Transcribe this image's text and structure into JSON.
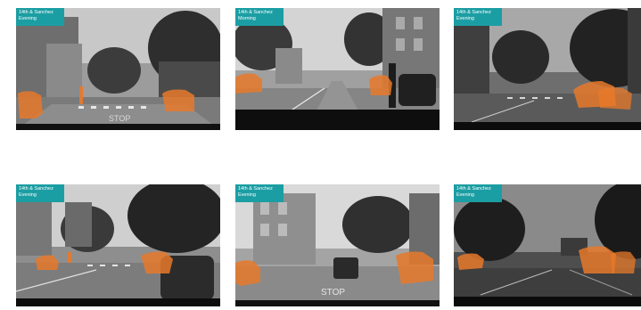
{
  "panels": [
    {
      "location": "14th & Sanchez",
      "time": "Evening"
    },
    {
      "location": "14th & Sanchez",
      "time": "Morning"
    },
    {
      "location": "14th & Sanchez",
      "time": "Evening"
    },
    {
      "location": "14th & Sanchez",
      "time": "Evening"
    },
    {
      "location": "14th & Sanchez",
      "time": "Evening"
    },
    {
      "location": "14th & Sanchez",
      "time": "Evening"
    }
  ],
  "road_markings": {
    "stop_text": "STOP"
  },
  "colors": {
    "label_background": "#1b9ea3",
    "highlight": "#e8792a"
  }
}
